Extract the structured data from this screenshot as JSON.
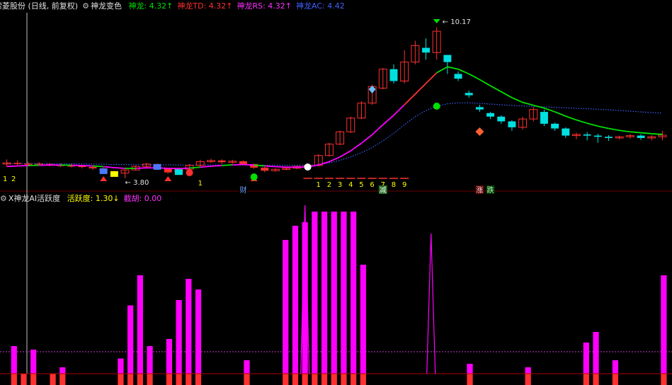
{
  "panel_top": {
    "title": "索菱股份 (日线, 前复权)",
    "indicator_name": "神龙变色",
    "values": [
      {
        "label": "神龙:",
        "value": "4.32",
        "arrow": "↑",
        "color": "#00e000"
      },
      {
        "label": "神龙TD:",
        "value": "4.32",
        "arrow": "↑",
        "color": "#ff3030"
      },
      {
        "label": "神龙RS:",
        "value": "4.32",
        "arrow": "↑",
        "color": "#ff30ff"
      },
      {
        "label": "神龙AC:",
        "value": "4.42",
        "arrow": "",
        "color": "#4060ff"
      }
    ],
    "price_high_label": "10.17",
    "price_low_label": "3.80",
    "count_labels": [
      "1",
      "2",
      "3",
      "4",
      "5",
      "6",
      "7",
      "8",
      "9"
    ],
    "early_counts": [
      "1",
      "2"
    ],
    "mid_count": "1",
    "badges": {
      "cai": "财",
      "jian": "减",
      "zhang": "涨",
      "die": "跌"
    }
  },
  "panel_bottom": {
    "indicator_name": "X神龙AI活跃度",
    "values": [
      {
        "label": "活跃度:",
        "value": "1.30",
        "arrow": "↓",
        "color": "#ffff00"
      },
      {
        "label": "截胡:",
        "value": "0.00",
        "arrow": "",
        "color": "#ff30ff"
      }
    ]
  },
  "colors": {
    "up": "#ff3030",
    "down": "#00e0e0",
    "magenta": "#ff00ff",
    "green": "#00e000",
    "blue": "#4060ff",
    "yellow": "#ffff00"
  },
  "chart_data": {
    "type": "bar",
    "candles": [
      {
        "o": 4.4,
        "c": 4.45,
        "h": 4.6,
        "l": 4.3
      },
      {
        "o": 4.45,
        "c": 4.42,
        "h": 4.55,
        "l": 4.35
      },
      {
        "o": 4.42,
        "c": 4.38,
        "h": 4.5,
        "l": 4.3
      },
      {
        "o": 4.38,
        "c": 4.4,
        "h": 4.48,
        "l": 4.32
      },
      {
        "o": 4.4,
        "c": 4.36,
        "h": 4.45,
        "l": 4.3
      },
      {
        "o": 4.36,
        "c": 4.34,
        "h": 4.42,
        "l": 4.28
      },
      {
        "o": 4.34,
        "c": 4.32,
        "h": 4.4,
        "l": 4.26
      },
      {
        "o": 4.32,
        "c": 4.28,
        "h": 4.36,
        "l": 4.22
      },
      {
        "o": 4.28,
        "c": 4.22,
        "h": 4.3,
        "l": 4.15
      },
      {
        "o": 4.22,
        "c": 4.1,
        "h": 4.25,
        "l": 4.05
      },
      {
        "o": 4.1,
        "c": 4.02,
        "h": 4.12,
        "l": 3.9
      },
      {
        "o": 4.02,
        "c": 4.15,
        "h": 4.18,
        "l": 3.8
      },
      {
        "o": 4.15,
        "c": 4.3,
        "h": 4.35,
        "l": 4.12
      },
      {
        "o": 4.3,
        "c": 4.4,
        "h": 4.46,
        "l": 4.25
      },
      {
        "o": 4.4,
        "c": 4.2,
        "h": 4.42,
        "l": 4.15
      },
      {
        "o": 4.2,
        "c": 4.05,
        "h": 4.22,
        "l": 4.0
      },
      {
        "o": 4.05,
        "c": 4.18,
        "h": 4.25,
        "l": 4.02
      },
      {
        "o": 4.18,
        "c": 4.35,
        "h": 4.4,
        "l": 4.15
      },
      {
        "o": 4.35,
        "c": 4.5,
        "h": 4.58,
        "l": 4.3
      },
      {
        "o": 4.5,
        "c": 4.55,
        "h": 4.62,
        "l": 4.45
      },
      {
        "o": 4.55,
        "c": 4.48,
        "h": 4.6,
        "l": 4.4
      },
      {
        "o": 4.48,
        "c": 4.52,
        "h": 4.58,
        "l": 4.42
      },
      {
        "o": 4.52,
        "c": 4.4,
        "h": 4.55,
        "l": 4.36
      },
      {
        "o": 4.4,
        "c": 4.25,
        "h": 4.42,
        "l": 4.2
      },
      {
        "o": 4.25,
        "c": 4.12,
        "h": 4.28,
        "l": 4.05
      },
      {
        "o": 4.12,
        "c": 4.18,
        "h": 4.22,
        "l": 4.08
      },
      {
        "o": 4.18,
        "c": 4.22,
        "h": 4.28,
        "l": 4.14
      },
      {
        "o": 4.22,
        "c": 4.3,
        "h": 4.34,
        "l": 4.18
      },
      {
        "o": 4.3,
        "c": 4.34,
        "h": 4.4,
        "l": 4.26
      },
      {
        "o": 4.34,
        "c": 4.76,
        "h": 4.82,
        "l": 4.3
      },
      {
        "o": 4.76,
        "c": 5.24,
        "h": 5.3,
        "l": 4.72
      },
      {
        "o": 5.24,
        "c": 5.76,
        "h": 5.82,
        "l": 5.2
      },
      {
        "o": 5.76,
        "c": 6.34,
        "h": 6.4,
        "l": 5.7
      },
      {
        "o": 6.34,
        "c": 6.97,
        "h": 7.05,
        "l": 6.3
      },
      {
        "o": 6.97,
        "c": 7.67,
        "h": 7.75,
        "l": 6.9
      },
      {
        "o": 7.6,
        "c": 8.4,
        "h": 8.45,
        "l": 7.55
      },
      {
        "o": 8.4,
        "c": 7.9,
        "h": 8.6,
        "l": 7.8
      },
      {
        "o": 7.9,
        "c": 8.7,
        "h": 9.2,
        "l": 7.8
      },
      {
        "o": 8.7,
        "c": 9.4,
        "h": 9.6,
        "l": 8.6
      },
      {
        "o": 9.3,
        "c": 9.1,
        "h": 9.7,
        "l": 8.8
      },
      {
        "o": 9.1,
        "c": 10.0,
        "h": 10.17,
        "l": 8.8
      },
      {
        "o": 9.0,
        "c": 8.7,
        "h": 9.0,
        "l": 8.2
      },
      {
        "o": 8.2,
        "c": 8.0,
        "h": 8.3,
        "l": 7.9
      },
      {
        "o": 7.4,
        "c": 7.3,
        "h": 7.5,
        "l": 7.2
      },
      {
        "o": 6.8,
        "c": 6.7,
        "h": 6.9,
        "l": 6.6
      },
      {
        "o": 6.55,
        "c": 6.4,
        "h": 6.6,
        "l": 6.3
      },
      {
        "o": 6.4,
        "c": 6.2,
        "h": 6.45,
        "l": 6.1
      },
      {
        "o": 6.2,
        "c": 5.95,
        "h": 6.25,
        "l": 5.8
      },
      {
        "o": 5.95,
        "c": 6.3,
        "h": 6.4,
        "l": 5.85
      },
      {
        "o": 6.3,
        "c": 6.7,
        "h": 6.8,
        "l": 6.2
      },
      {
        "o": 6.6,
        "c": 6.1,
        "h": 6.7,
        "l": 6.0
      },
      {
        "o": 6.1,
        "c": 5.9,
        "h": 6.15,
        "l": 5.8
      },
      {
        "o": 5.9,
        "c": 5.6,
        "h": 5.95,
        "l": 5.5
      },
      {
        "o": 5.6,
        "c": 5.65,
        "h": 5.72,
        "l": 5.45
      },
      {
        "o": 5.65,
        "c": 5.6,
        "h": 5.75,
        "l": 5.4
      },
      {
        "o": 5.6,
        "c": 5.55,
        "h": 5.68,
        "l": 5.3
      },
      {
        "o": 5.55,
        "c": 5.5,
        "h": 5.62,
        "l": 5.38
      },
      {
        "o": 5.5,
        "c": 5.55,
        "h": 5.6,
        "l": 5.44
      },
      {
        "o": 5.55,
        "c": 5.6,
        "h": 5.66,
        "l": 5.48
      },
      {
        "o": 5.6,
        "c": 5.5,
        "h": 5.66,
        "l": 5.42
      },
      {
        "o": 5.5,
        "c": 5.55,
        "h": 5.62,
        "l": 5.4
      },
      {
        "o": 5.55,
        "c": 5.62,
        "h": 5.8,
        "l": 5.4
      }
    ],
    "ma_line": [
      4.3,
      4.32,
      4.34,
      4.35,
      4.36,
      4.36,
      4.35,
      4.34,
      4.32,
      4.29,
      4.25,
      4.22,
      4.22,
      4.24,
      4.24,
      4.22,
      4.21,
      4.23,
      4.27,
      4.31,
      4.34,
      4.37,
      4.38,
      4.36,
      4.32,
      4.29,
      4.27,
      4.27,
      4.28,
      4.36,
      4.5,
      4.7,
      4.96,
      5.28,
      5.64,
      6.06,
      6.46,
      6.9,
      7.35,
      7.8,
      8.25,
      8.5,
      8.4,
      8.2,
      7.96,
      7.7,
      7.45,
      7.2,
      7.0,
      6.88,
      6.76,
      6.6,
      6.42,
      6.26,
      6.12,
      6.0,
      5.9,
      5.82,
      5.76,
      5.72,
      5.68,
      5.65
    ],
    "ac_line": [
      4.42,
      4.42,
      4.42,
      4.42,
      4.42,
      4.41,
      4.41,
      4.4,
      4.4,
      4.39,
      4.38,
      4.38,
      4.37,
      4.37,
      4.37,
      4.37,
      4.36,
      4.36,
      4.36,
      4.36,
      4.36,
      4.36,
      4.36,
      4.36,
      4.35,
      4.35,
      4.35,
      4.35,
      4.35,
      4.38,
      4.45,
      4.56,
      4.7,
      4.88,
      5.1,
      5.38,
      5.7,
      6.06,
      6.4,
      6.66,
      6.84,
      6.94,
      6.98,
      6.98,
      6.96,
      6.93,
      6.9,
      6.87,
      6.85,
      6.83,
      6.81,
      6.79,
      6.77,
      6.75,
      6.73,
      6.71,
      6.69,
      6.66,
      6.63,
      6.6,
      6.57,
      6.55
    ],
    "activity": [
      0.0,
      0.22,
      0.02,
      0.2,
      0.0,
      0.01,
      0.1,
      0.0,
      0.0,
      0.0,
      0.0,
      0.0,
      0.15,
      0.45,
      0.62,
      0.22,
      0.0,
      0.26,
      0.48,
      0.6,
      0.54,
      0.0,
      0.0,
      0.0,
      0.0,
      0.14,
      0.0,
      0.0,
      0.0,
      0.82,
      0.9,
      0.92,
      0.98,
      0.98,
      0.98,
      0.98,
      0.98,
      0.68,
      0.0,
      0.0,
      0.0,
      0.0,
      0.0,
      0.0,
      0.0,
      0.0,
      0.0,
      0.0,
      0.12,
      0.0,
      0.0,
      0.0,
      0.0,
      0.0,
      0.1,
      0.0,
      0.0,
      0.0,
      0.0,
      0.0,
      0.24,
      0.3,
      0.0,
      0.14,
      0.0,
      0.0,
      0.0,
      0.0,
      0.62
    ],
    "ylim": [
      3.5,
      10.6
    ]
  }
}
